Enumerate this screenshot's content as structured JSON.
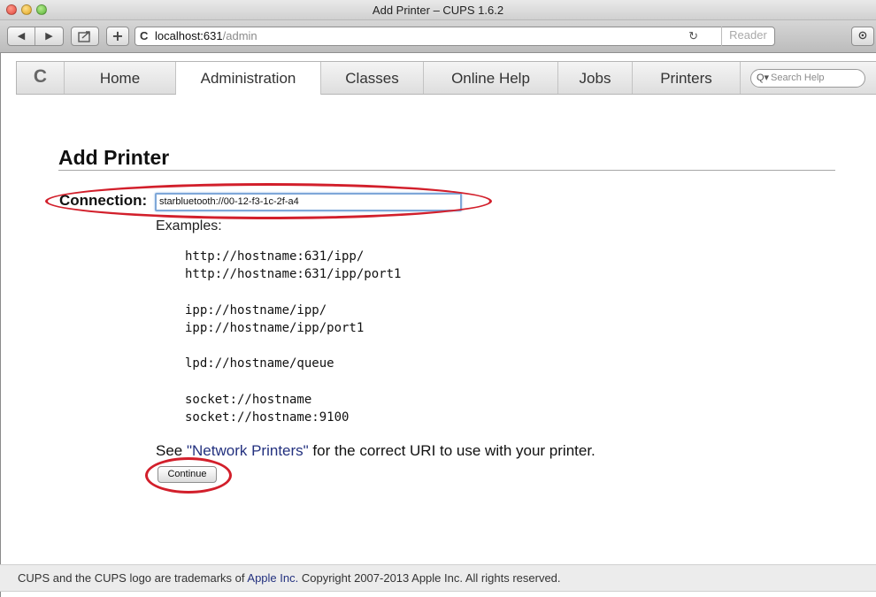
{
  "window": {
    "title": "Add Printer – CUPS 1.6.2"
  },
  "toolbar": {
    "url_host": "localhost:631",
    "url_path": "/admin",
    "reader_label": "Reader",
    "icons": [
      "back-icon",
      "forward-icon",
      "share-icon",
      "new-tab-icon",
      "reload-icon",
      "downloads-icon"
    ]
  },
  "nav": {
    "logo_icon": "cups-logo",
    "tabs": [
      {
        "label": "Home"
      },
      {
        "label": "Administration",
        "active": true
      },
      {
        "label": "Classes"
      },
      {
        "label": "Online Help"
      },
      {
        "label": "Jobs"
      },
      {
        "label": "Printers"
      }
    ],
    "search_placeholder": "Search Help"
  },
  "main": {
    "heading": "Add Printer",
    "connection_label": "Connection:",
    "connection_value": "starbluetooth://00-12-f3-1c-2f-a4",
    "examples_title": "Examples:",
    "examples": [
      "http://hostname:631/ipp/",
      "http://hostname:631/ipp/port1",
      "ipp://hostname/ipp/",
      "ipp://hostname/ipp/port1",
      "lpd://hostname/queue",
      "socket://hostname",
      "socket://hostname:9100"
    ],
    "see_prefix": "See ",
    "see_link": "\"Network Printers\"",
    "see_suffix": " for the correct URI to use with your printer.",
    "continue_label": "Continue"
  },
  "footer": {
    "prefix": "CUPS and the CUPS logo are trademarks of ",
    "link": "Apple Inc.",
    "suffix": " Copyright 2007-2013 Apple Inc. All rights reserved."
  },
  "colors": {
    "annotation": "#d21f2b",
    "link": "#23317f",
    "focus_ring": "#7ea7d8"
  }
}
